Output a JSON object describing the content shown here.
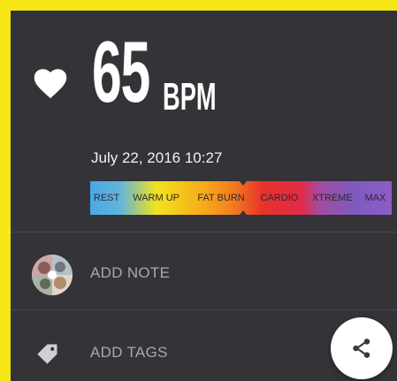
{
  "reading": {
    "value": "65",
    "unit": "BPM",
    "timestamp": "July 22, 2016 10:27"
  },
  "zones": {
    "items": [
      "REST",
      "WARM UP",
      "FAT BURN",
      "CARDIO",
      "XTREME",
      "MAX"
    ]
  },
  "actions": {
    "add_note": "ADD NOTE",
    "add_tags": "ADD TAGS"
  },
  "icons": {
    "heart": "heart-icon",
    "tag": "tag-icon",
    "share": "share-icon"
  },
  "colors": {
    "background": "#333338",
    "frame": "#f7e616",
    "text": "#ffffff",
    "muted_text": "#a8a8ad"
  }
}
